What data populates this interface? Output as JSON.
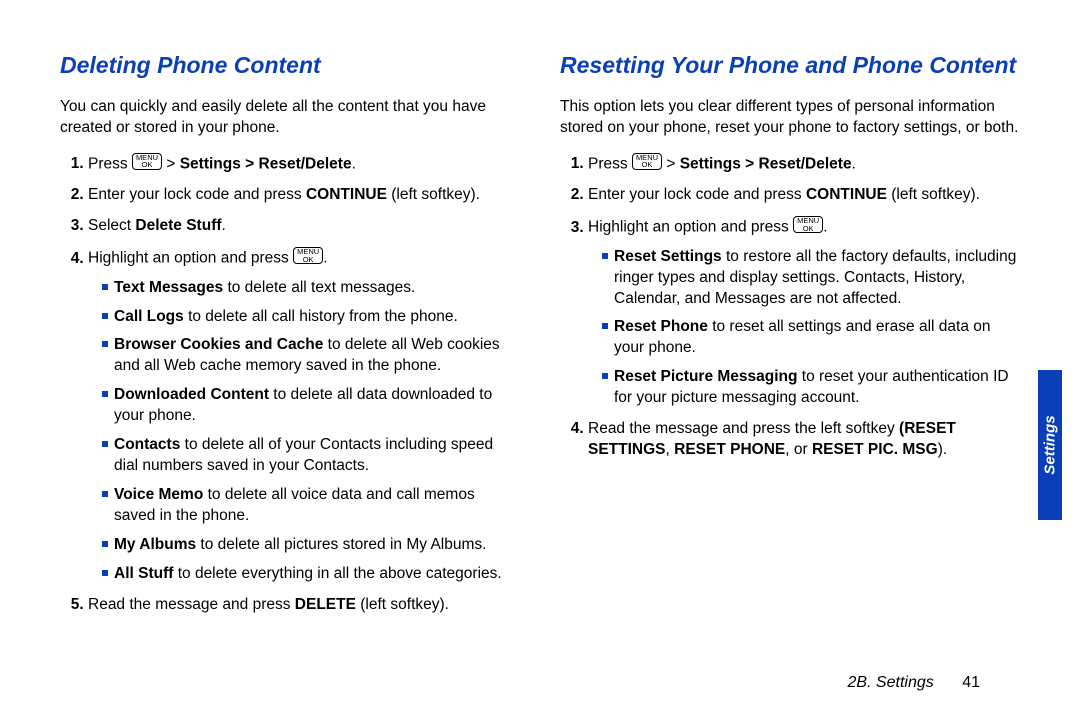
{
  "menuok": {
    "line1": "MENU",
    "line2": "OK"
  },
  "left": {
    "title": "Deleting Phone Content",
    "intro": "You can quickly and easily delete all the content that you have created or stored in your phone.",
    "step1_a": "Press ",
    "step1_b": " > ",
    "step1_b_bold": "Settings > Reset/Delete",
    "step1_c": ".",
    "step2_a": "Enter your lock code and press ",
    "step2_b_bold": "CONTINUE",
    "step2_c": " (left softkey).",
    "step3_a": "Select ",
    "step3_b_bold": "Delete Stuff",
    "step3_c": ".",
    "step4_a": "Highlight an option and press ",
    "step4_c": ".",
    "sub": {
      "s1_b": "Text Messages",
      "s1_t": " to delete all text messages.",
      "s2_b": "Call Logs",
      "s2_t": " to delete all call history from the phone.",
      "s3_b": "Browser Cookies and Cache",
      "s3_t": " to delete all Web cookies and all Web cache memory saved in the phone.",
      "s4_b": "Downloaded Content",
      "s4_t": " to delete all data downloaded to your phone.",
      "s5_b": "Contacts",
      "s5_t": " to delete all of your Contacts including speed dial numbers saved in your Contacts.",
      "s6_b": "Voice Memo",
      "s6_t": " to delete all voice data and call memos saved in the phone.",
      "s7_b": "My Albums",
      "s7_t": " to delete all pictures stored in My Albums.",
      "s8_b": "All Stuff",
      "s8_t": " to delete everything in all the above categories."
    },
    "step5_a": "Read the message and press ",
    "step5_b_bold": "DELETE",
    "step5_c": " (left softkey)."
  },
  "right": {
    "title": "Resetting Your Phone and Phone Content",
    "intro": "This option lets you clear different types of personal information stored on your phone, reset your phone to factory settings, or both.",
    "step1_a": "Press ",
    "step1_b": " > ",
    "step1_b_bold": "Settings > Reset/Delete",
    "step1_c": ".",
    "step2_a": "Enter your lock code and press ",
    "step2_b_bold": "CONTINUE",
    "step2_c": " (left softkey).",
    "step3_a": "Highlight an option and press ",
    "step3_c": ".",
    "sub": {
      "s1_b": "Reset Settings",
      "s1_t": " to restore all the factory defaults, including ringer types and display settings. Contacts, History, Calendar, and Messages are not affected.",
      "s2_b": "Reset Phone",
      "s2_t": " to reset all settings and erase all data on your phone.",
      "s3_b": "Reset Picture Messaging",
      "s3_t": " to reset your authentication ID for your picture messaging account."
    },
    "step4_a": "Read the message and press the left softkey ",
    "step4_b1": "RESET SETTINGS",
    "step4_m1": ", ",
    "step4_b2": "RESET PHONE",
    "step4_m2": ", or ",
    "step4_b3": "RESET PIC. MSG",
    "step4_c": ")."
  },
  "footer": {
    "section": "2B. Settings",
    "page": "41"
  },
  "sidetab": "Settings"
}
